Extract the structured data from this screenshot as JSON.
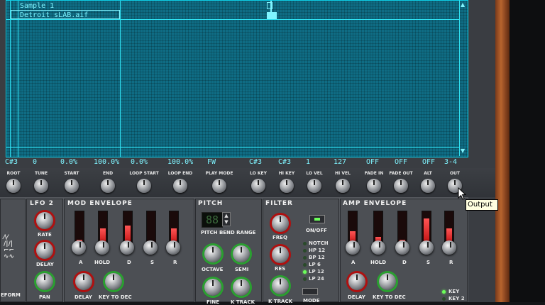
{
  "sample_list": {
    "items": [
      "Sample 1",
      "Detroit_sLAB.aif"
    ],
    "selected_index": 1
  },
  "params": [
    "C#3",
    "0",
    "0.0%",
    "100.0%",
    "0.0%",
    "100.0%",
    "FW",
    "C#3",
    "C#3",
    "1",
    "127",
    "OFF",
    "OFF",
    "OFF",
    "3-4"
  ],
  "knob_labels": [
    "ROOT",
    "TUNE",
    "START",
    "END",
    "LOOP START",
    "LOOP END",
    "PLAY MODE",
    "LO KEY",
    "HI KEY",
    "LO VEL",
    "HI VEL",
    "FADE IN",
    "FADE OUT",
    "ALT",
    "OUT"
  ],
  "sections": {
    "lfo2": {
      "title": "LFO 2",
      "rate": "RATE",
      "delay": "DELAY",
      "pan": "PAN"
    },
    "mod_env": {
      "title": "MOD ENVELOPE",
      "a": "A",
      "hold": "HOLD",
      "d": "D",
      "s": "S",
      "r": "R",
      "delay": "DELAY",
      "key_to_dec": "KEY TO DEC"
    },
    "pitch": {
      "title": "PITCH",
      "display_value": "88",
      "bend_range": "PITCH BEND RANGE",
      "octave": "OCTAVE",
      "semi": "SEMI",
      "fine": "FINE",
      "k_track": "K TRACK"
    },
    "filter": {
      "title": "FILTER",
      "on_off": "ON/OFF",
      "freq": "FREQ",
      "res": "RES",
      "k_track": "K TRACK",
      "mode": "MODE",
      "types": [
        "NOTCH",
        "HP 12",
        "BP 12",
        "LP 6",
        "LP 12",
        "LP 24"
      ],
      "selected_type": "LP 12"
    },
    "amp_env": {
      "title": "AMP ENVELOPE",
      "a": "A",
      "hold": "HOLD",
      "d": "D",
      "s": "S",
      "r": "R",
      "delay": "DELAY",
      "key_to_dec": "KEY TO DEC",
      "key": "KEY",
      "key2": "KEY 2"
    },
    "waveform": {
      "label": "EFORM"
    }
  },
  "tooltip": "Output",
  "colors": {
    "screen": "#0f6c84",
    "screen_text": "#7ff4ff",
    "fader": "#e02020",
    "led_on": "#6cff5a"
  },
  "icons": {
    "cursor": "arrow-cursor-icon"
  }
}
